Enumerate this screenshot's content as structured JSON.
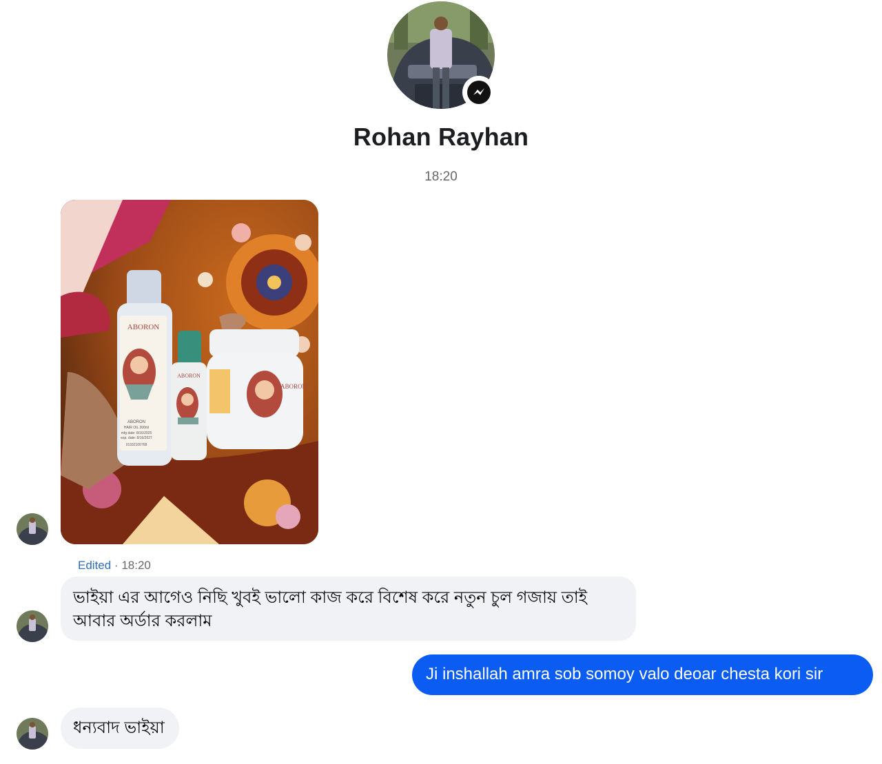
{
  "header": {
    "contact_name": "Rohan Rayhan",
    "time": "18:20",
    "badge_icon": "messenger-icon"
  },
  "photo_message": {
    "label_big": "ABORON",
    "label_small": "ABORON",
    "label_jar": "ABORON",
    "product_line": "ABORON",
    "product_type": "HAIR OIL 200ml",
    "mfg": "mfg date: 8/16/2025",
    "exp": "exp. date: 8/16/2027",
    "phone": "01332100768"
  },
  "edited_meta": {
    "edited": "Edited",
    "separator": " · ",
    "time": "18:20"
  },
  "messages": [
    {
      "direction": "incoming",
      "text": "ভাইয়া এর আগেও নিছি খুবই ভালো কাজ করে বিশেষ করে নতুন চুল গজায় তাই আবার অর্ডার করলাম"
    },
    {
      "direction": "outgoing",
      "text": "Ji inshallah amra sob somoy valo deoar chesta kori sir"
    },
    {
      "direction": "incoming",
      "text": "ধন্যবাদ ভাইয়া"
    }
  ],
  "colors": {
    "outgoing_bubble": "#0a5cf2",
    "incoming_bubble": "#f0f2f5",
    "edited_label": "#2b6fb6",
    "meta_text": "#65676b"
  }
}
